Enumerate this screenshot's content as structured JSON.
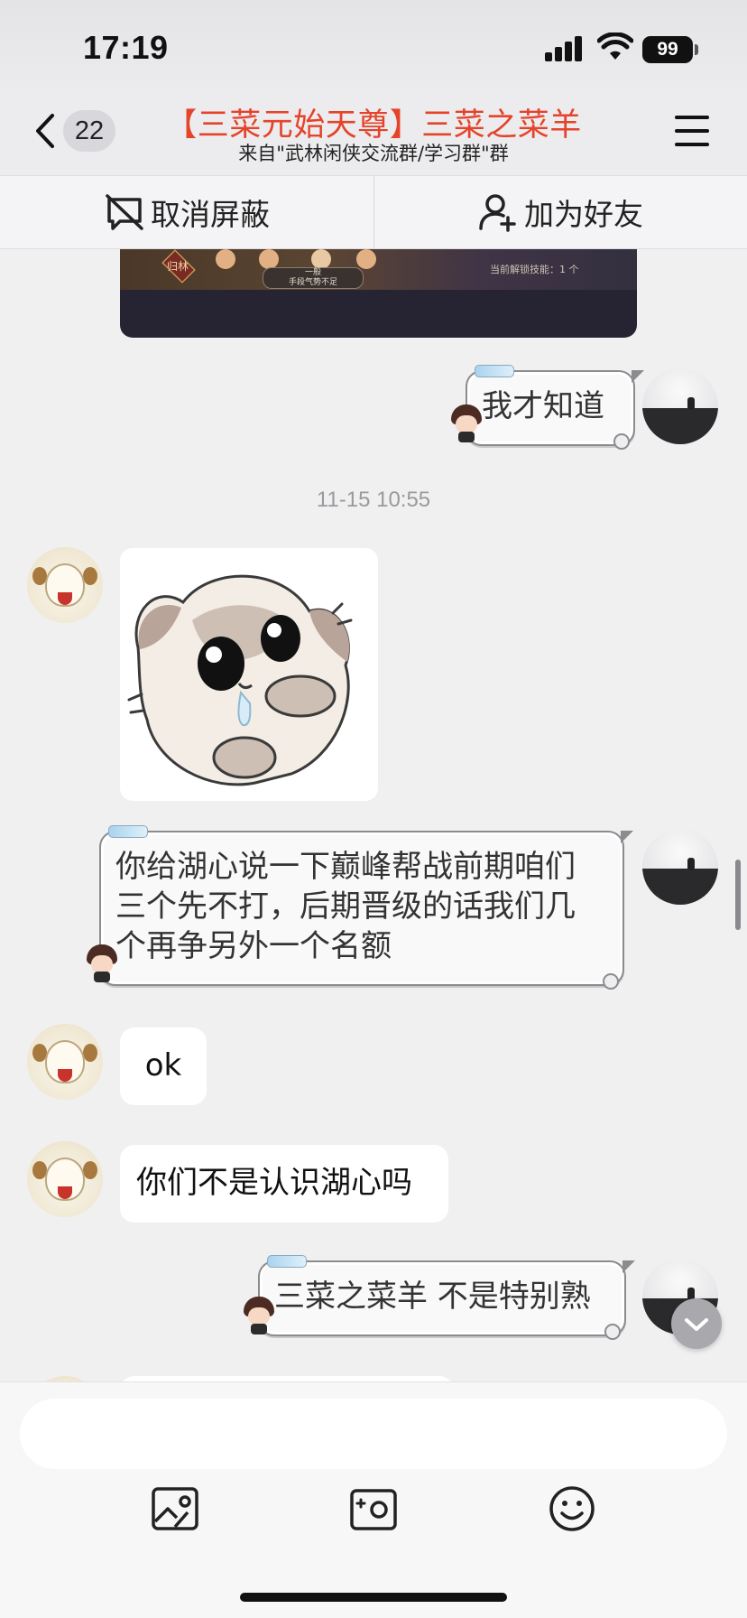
{
  "status_bar": {
    "time": "17:19",
    "battery": "99"
  },
  "header": {
    "back_badge": "22",
    "title": "【三菜元始天尊】三菜之菜羊",
    "subtitle": "来自\"武林闲侠交流群/学习群\"群",
    "title_color": "#e5432a"
  },
  "action_bar": {
    "unblock_label": "取消屏蔽",
    "add_friend_label": "加为好友"
  },
  "messages": {
    "m1_text": "我才知道",
    "timestamp": "11-15 10:55",
    "m3_line1": "你给湖心说一下巅峰帮战前期咱们",
    "m3_line2": "三个先不打，后期晋级的话我们几",
    "m3_line3": "个再争另外一个名额",
    "m4_text": "ok",
    "m5_text": "你们不是认识湖心吗",
    "m6_text": "三菜之菜羊 不是特别熟"
  },
  "image_preview": {
    "caption_small": "当前解锁技能：1 个",
    "left_label": "归林",
    "center_label_1": "一般",
    "center_label_2": "手段气势不足"
  },
  "input": {
    "placeholder": ""
  },
  "icons": {
    "back": "chevron-left-icon",
    "menu": "hamburger-icon",
    "unblock": "block-off-icon",
    "add_friend": "user-add-icon",
    "photo": "image-icon",
    "camera": "camera-icon",
    "emoji": "emoji-icon",
    "scroll_down": "chevron-down-icon"
  }
}
